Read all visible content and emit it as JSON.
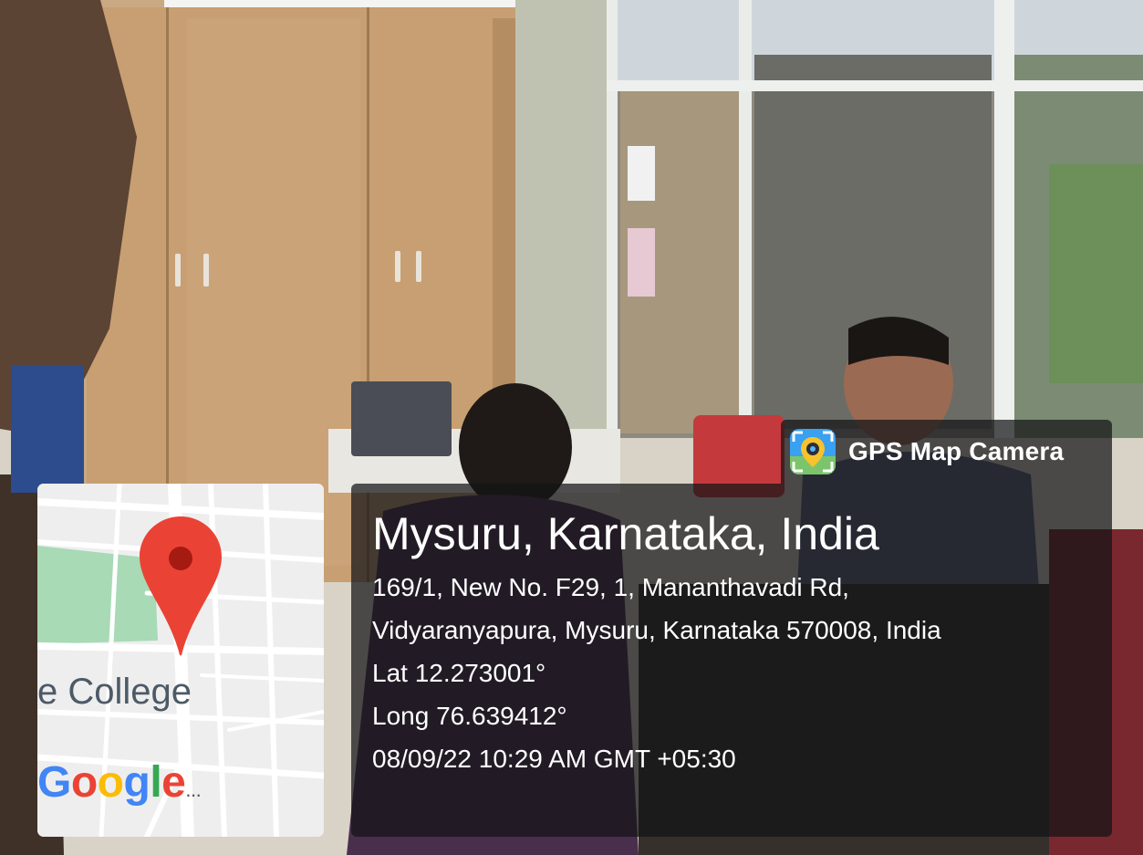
{
  "badge": {
    "app_name": "GPS Map Camera",
    "icon": "camera-pin-icon"
  },
  "location": {
    "place": "Mysuru, Karnataka, India",
    "address_line_1": "169/1, New No. F29, 1, Mananthavadi Rd,",
    "address_line_2": "Vidyaranyapura, Mysuru, Karnataka 570008, India",
    "latitude": "Lat 12.273001°",
    "longitude": "Long 76.639412°",
    "datetime": "08/09/22 10:29 AM GMT +05:30"
  },
  "map": {
    "label": "e College",
    "marker_icon": "map-pin-icon",
    "logo": [
      "G",
      "o",
      "o",
      "g",
      "l",
      "e",
      "..."
    ],
    "colors": {
      "park": "#a8dab5",
      "roads": "#ffffff",
      "land": "#eeeeef",
      "pin": "#ea4335",
      "pin_center": "#a51b12"
    }
  },
  "colors": {
    "overlay": "#141416",
    "text": "#ffffff"
  }
}
